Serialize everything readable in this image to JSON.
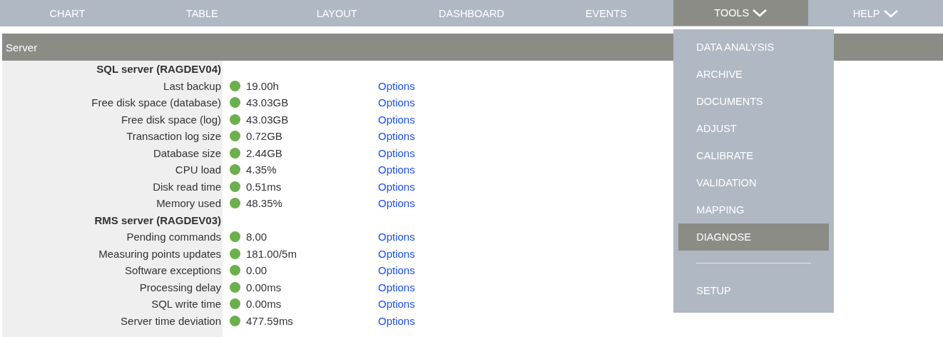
{
  "nav": [
    {
      "label": "CHART",
      "selected": false,
      "has_caret": false
    },
    {
      "label": "TABLE",
      "selected": false,
      "has_caret": false
    },
    {
      "label": "LAYOUT",
      "selected": false,
      "has_caret": false
    },
    {
      "label": "DASHBOARD",
      "selected": false,
      "has_caret": false
    },
    {
      "label": "EVENTS",
      "selected": false,
      "has_caret": false
    },
    {
      "label": "TOOLS",
      "selected": true,
      "has_caret": true
    },
    {
      "label": "HELP",
      "selected": false,
      "has_caret": true
    }
  ],
  "tools_menu": [
    {
      "kind": "item",
      "label": "DATA ANALYSIS",
      "selected": false
    },
    {
      "kind": "item",
      "label": "ARCHIVE",
      "selected": false
    },
    {
      "kind": "item",
      "label": "DOCUMENTS",
      "selected": false
    },
    {
      "kind": "item",
      "label": "ADJUST",
      "selected": false
    },
    {
      "kind": "item",
      "label": "CALIBRATE",
      "selected": false
    },
    {
      "kind": "item",
      "label": "VALIDATION",
      "selected": false
    },
    {
      "kind": "item",
      "label": "MAPPING",
      "selected": false
    },
    {
      "kind": "item",
      "label": "DIAGNOSE",
      "selected": true
    },
    {
      "kind": "separator"
    },
    {
      "kind": "item",
      "label": "SETUP",
      "selected": false
    }
  ],
  "panel": {
    "title": "Server",
    "groups": [
      {
        "heading": "SQL server (RAGDEV04)",
        "rows": [
          {
            "label": "Last backup",
            "color": "#6ab04c",
            "value": "19.00h",
            "link": "Options"
          },
          {
            "label": "Free disk space (database)",
            "color": "#6ab04c",
            "value": "43.03GB",
            "link": "Options"
          },
          {
            "label": "Free disk space (log)",
            "color": "#6ab04c",
            "value": "43.03GB",
            "link": "Options"
          },
          {
            "label": "Transaction log size",
            "color": "#6ab04c",
            "value": "0.72GB",
            "link": "Options"
          },
          {
            "label": "Database size",
            "color": "#6ab04c",
            "value": "2.44GB",
            "link": "Options"
          },
          {
            "label": "CPU load",
            "color": "#6ab04c",
            "value": "4.35%",
            "link": "Options"
          },
          {
            "label": "Disk read time",
            "color": "#6ab04c",
            "value": "0.51ms",
            "link": "Options"
          },
          {
            "label": "Memory used",
            "color": "#6ab04c",
            "value": "48.35%",
            "link": "Options"
          }
        ]
      },
      {
        "heading": "RMS server (RAGDEV03)",
        "rows": [
          {
            "label": "Pending commands",
            "color": "#6ab04c",
            "value": "8.00",
            "link": "Options"
          },
          {
            "label": "Measuring points updates",
            "color": "#6ab04c",
            "value": "181.00/5m",
            "link": "Options"
          },
          {
            "label": "Software exceptions",
            "color": "#6ab04c",
            "value": "0.00",
            "link": "Options"
          },
          {
            "label": "Processing delay",
            "color": "#6ab04c",
            "value": "0.00ms",
            "link": "Options"
          },
          {
            "label": "SQL write time",
            "color": "#6ab04c",
            "value": "0.00ms",
            "link": "Options"
          },
          {
            "label": "Server time deviation",
            "color": "#6ab04c",
            "value": "477.59ms",
            "link": "Options"
          }
        ]
      }
    ]
  }
}
